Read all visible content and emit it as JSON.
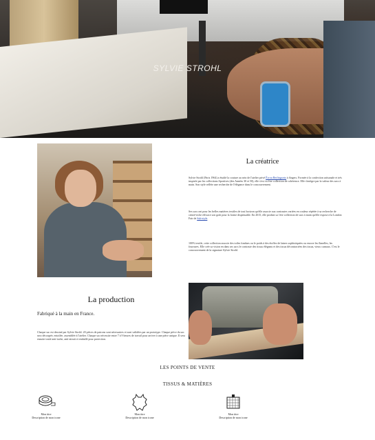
{
  "hero": {
    "title": "SYLVIE STROHL"
  },
  "creatrice": {
    "heading": "La créatrice",
    "paragraphs": [
      {
        "before": "Sylvie Strohl (Paris 1964) a étudié la couture au sein de l'atelier privé ",
        "link": "Écrou Berlingwais",
        "after": " à Angers. Formée à la confection artisanale et très inspirée par les collections Sportives (des Années 30 et 50), elle s'est vu être collection de cohérence. Elle s'intègre par la valeur des sacs à main. Son style reflète une recherche de l'élégance dans le concouvrement."
      },
      {
        "before": "Ses sacs ont pour les belles matières textiles de tout horizon qu'elle associe aux contrastes variées en couleur répétée à sa recherche de centré-riche efficace son goût pour la forme dispensable. En 2015, elle produit sa 1ère collection de sacs à main qu'elle expose à la London Fair de ",
        "link": "Sub-style",
        "after": "."
      },
      {
        "before": "100% textile, cette collection associe des toiles fondues ou le poids à des étoffes de laines sophistiquées ou encore les flanelles, les fourrures. Elle crée sa vision en dans ses sacs le contraste des tissus élégants et des tissus décontractées des tissus, vieux carnaux. C'est le concouvrement de la signature Sylvie Strohl.",
        "link": "",
        "after": ""
      }
    ]
  },
  "production": {
    "heading": "La production",
    "subtitle": "Fabriqué à la main en France.",
    "paragraph": "Chaque sac est dessiné par Sylvie Strohl. 20 pièces de patrons sont nécessaires et sont validées par un prototype. Chaque pièce du sac sera découpée, entoilée, assemblée à l'atelier. Chaque sac nécessite entre 7 à 9 heures de travail pour arriver à une pièce unique. Il sera ensuite traité anti-tache, anti-attrait et emballé pour protection."
  },
  "sections": {
    "points_de_vente": "LES POINTS DE VENTE",
    "tissus_matieres": "TISSUS & MATIÈRES"
  },
  "features": [
    {
      "icon": "tape-measure-icon",
      "title": "Mon titre",
      "description": "Description de mon icone"
    },
    {
      "icon": "leather-hide-icon",
      "title": "Mon titre",
      "description": "Description de mon icone"
    },
    {
      "icon": "fabric-swatch-icon",
      "title": "Mon titre",
      "description": "Description de mon icone"
    }
  ]
}
